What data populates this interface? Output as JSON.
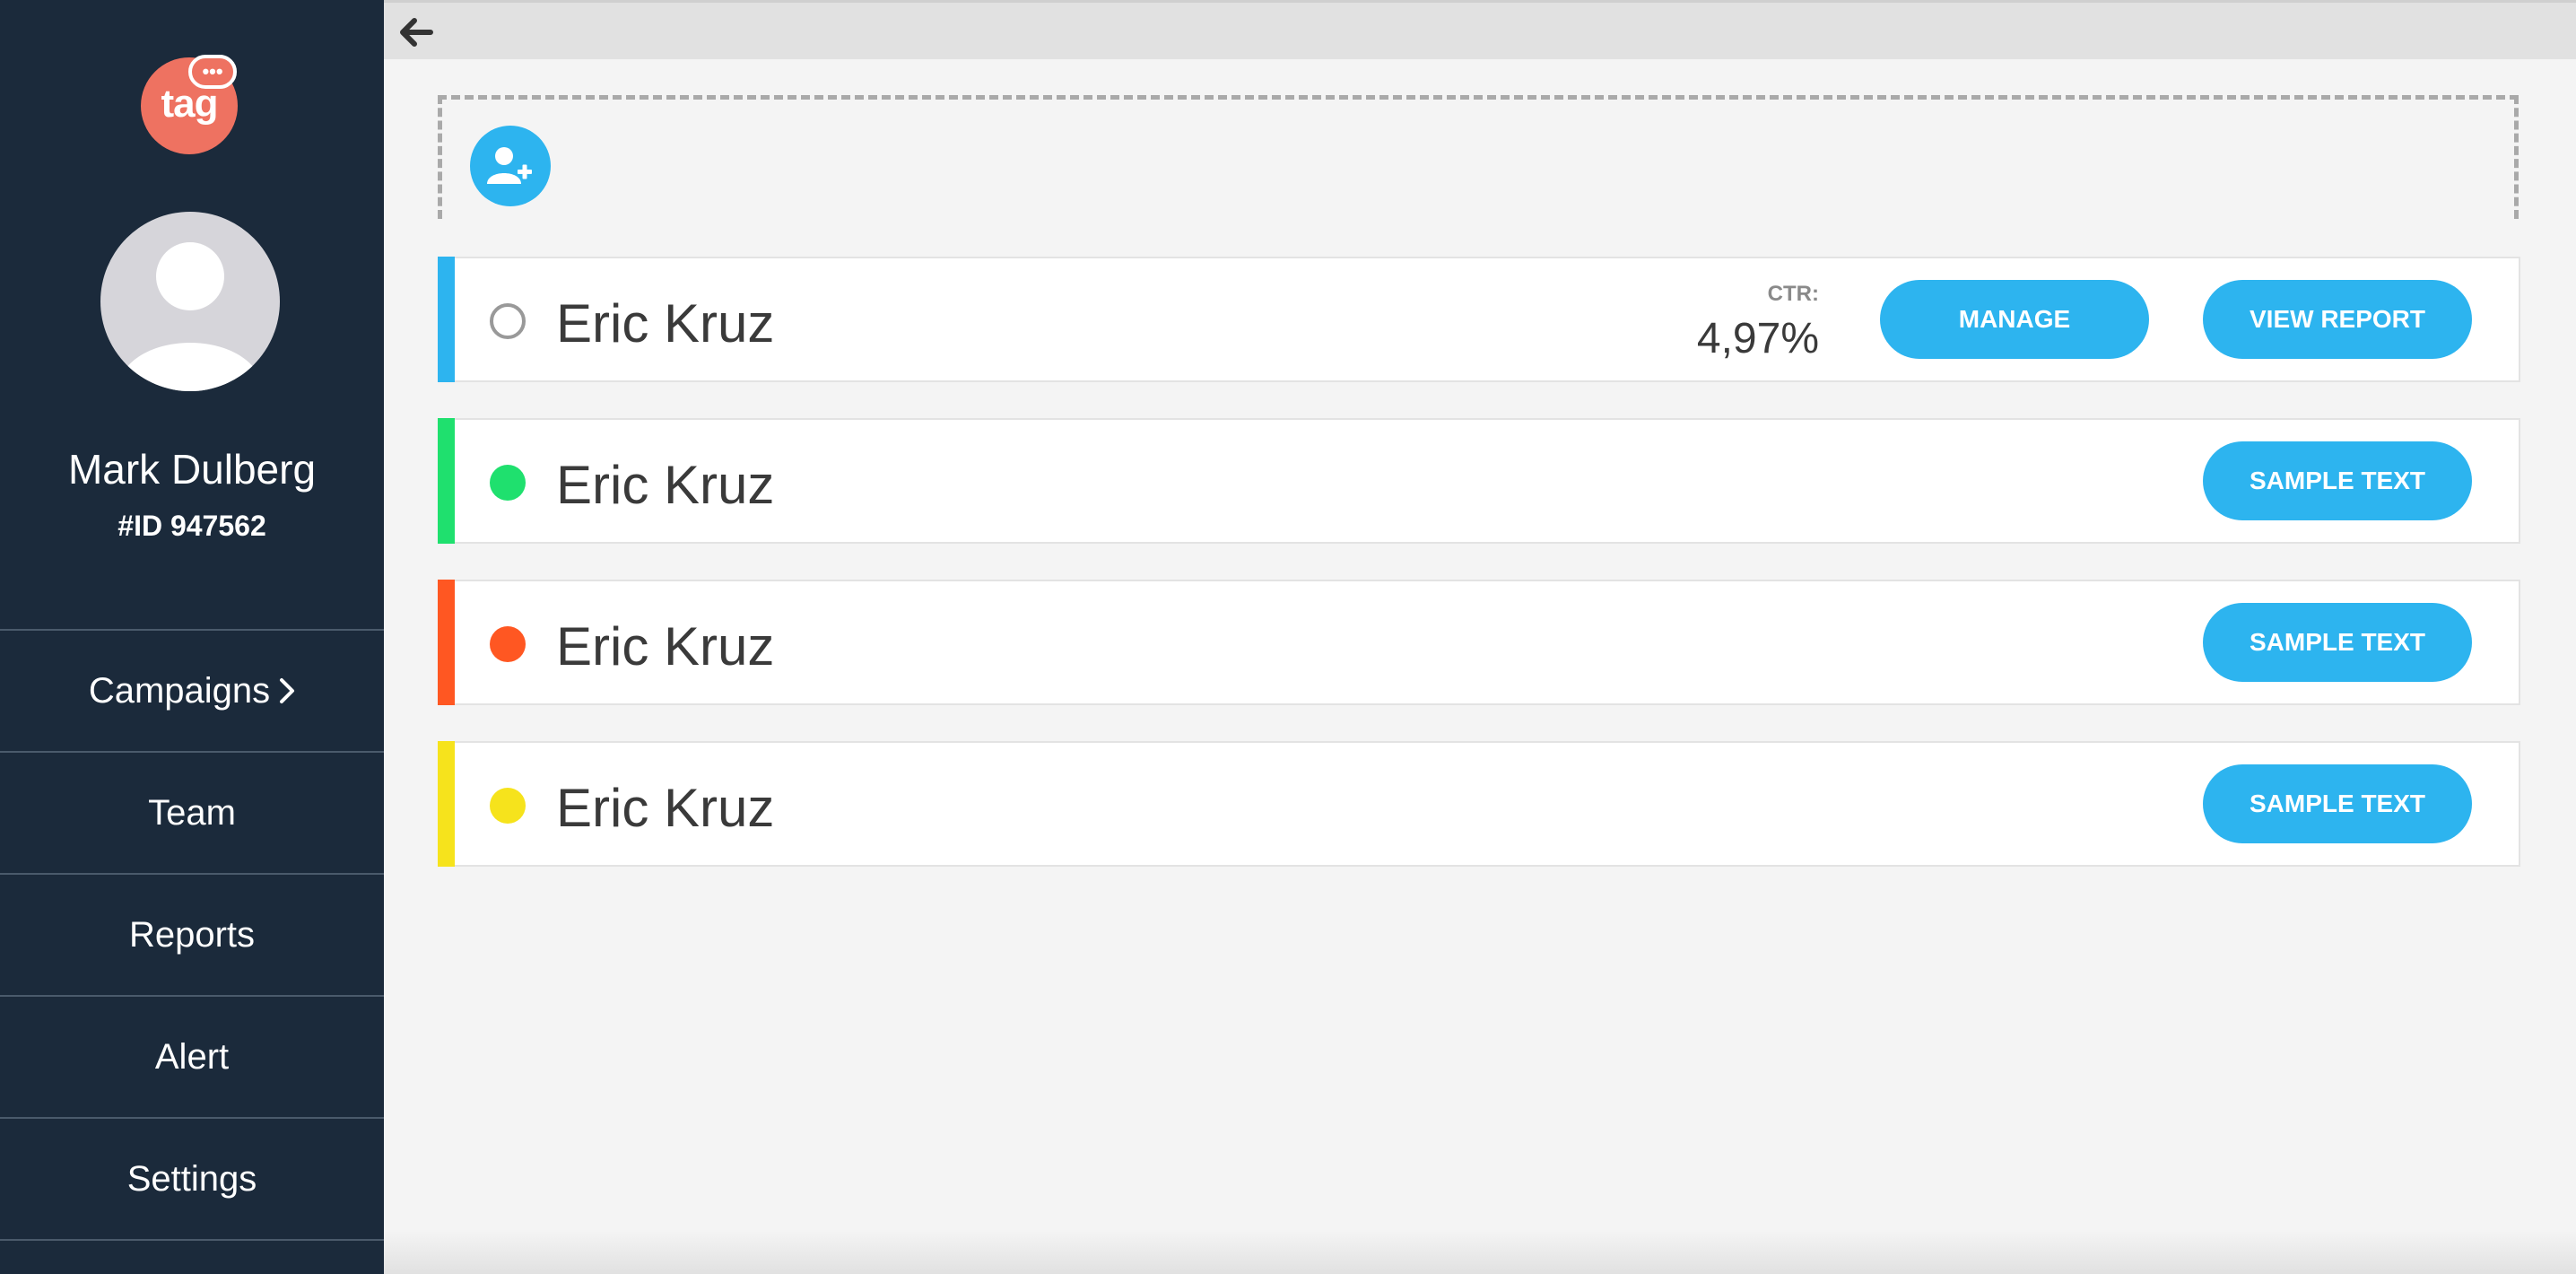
{
  "sidebar": {
    "logo_text": "tag",
    "logo_bubble": "•••",
    "user_name": "Mark Dulberg",
    "user_id": "#ID 947562",
    "nav": [
      {
        "label": "Campaigns",
        "has_chevron": true
      },
      {
        "label": "Team"
      },
      {
        "label": "Reports"
      },
      {
        "label": "Alert"
      },
      {
        "label": "Settings"
      }
    ]
  },
  "toolbar": {
    "back_icon": "arrow-left-icon"
  },
  "add_button": {
    "icon": "add-user-icon"
  },
  "rows": [
    {
      "name": "Eric Kruz",
      "status": "inactive",
      "accent_color": "#2db4ef",
      "dot_color": "#ffffff",
      "ctr_label": "CTR:",
      "ctr_value": "4,97%",
      "buttons": [
        "MANAGE",
        "VIEW REPORT"
      ]
    },
    {
      "name": "Eric Kruz",
      "status": "active",
      "accent_color": "#1fe06e",
      "dot_color": "#1fe06e",
      "buttons": [
        "SAMPLE TEXT"
      ]
    },
    {
      "name": "Eric Kruz",
      "status": "error",
      "accent_color": "#ff5722",
      "dot_color": "#ff5722",
      "buttons": [
        "SAMPLE TEXT"
      ]
    },
    {
      "name": "Eric Kruz",
      "status": "warning",
      "accent_color": "#f6e31c",
      "dot_color": "#f6e31c",
      "buttons": [
        "SAMPLE TEXT"
      ]
    }
  ],
  "colors": {
    "sidebar_bg": "#1b2a3b",
    "accent": "#2db4ef",
    "logo": "#ee7261"
  }
}
